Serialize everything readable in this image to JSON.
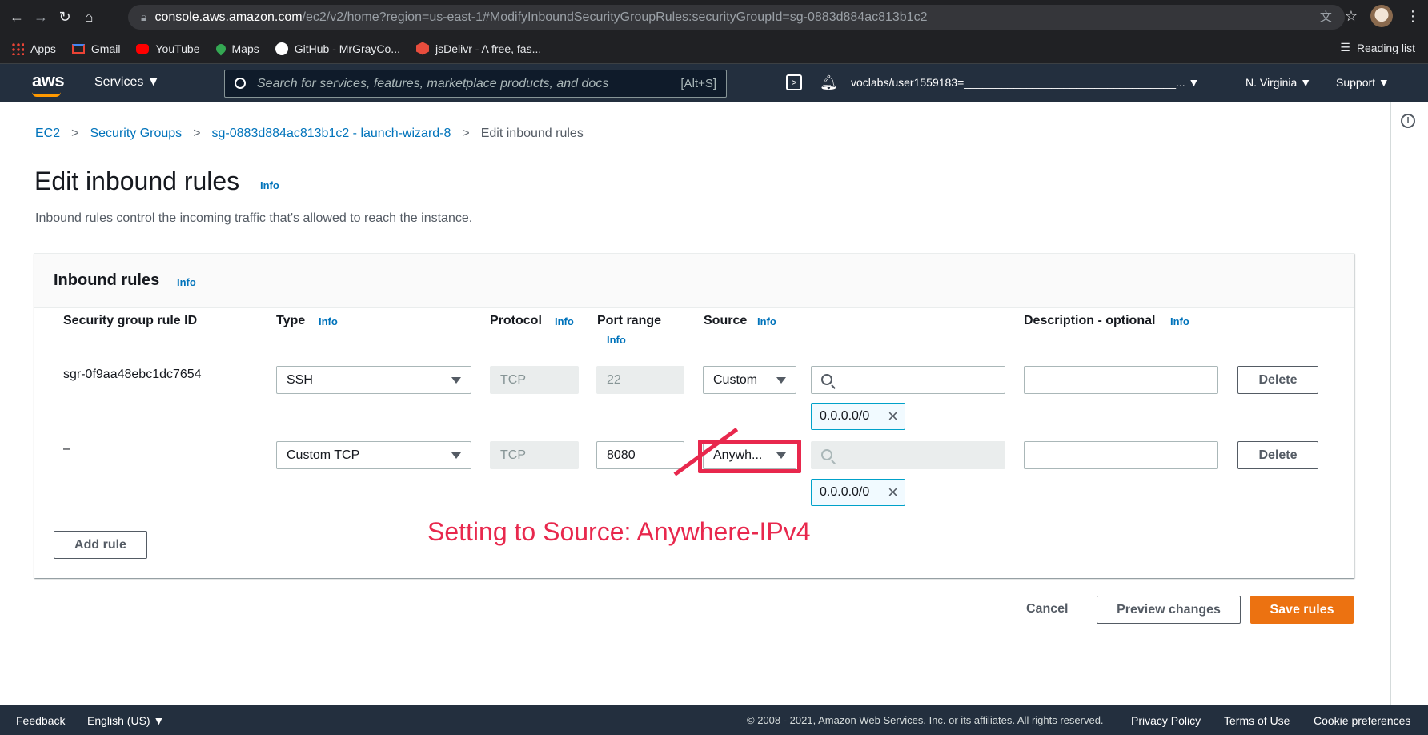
{
  "browser": {
    "url_host": "console.aws.amazon.com",
    "url_path": "/ec2/v2/home?region=us-east-1#ModifyInboundSecurityGroupRules:securityGroupId=sg-0883d884ac813b1c2",
    "bookmarks": [
      {
        "label": "Apps",
        "icon": "apps-grid-icon"
      },
      {
        "label": "Gmail",
        "icon": "gmail-icon"
      },
      {
        "label": "YouTube",
        "icon": "youtube-icon"
      },
      {
        "label": "Maps",
        "icon": "maps-icon"
      },
      {
        "label": "GitHub - MrGrayCo...",
        "icon": "github-icon"
      },
      {
        "label": "jsDelivr - A free, fas...",
        "icon": "jsdelivr-icon"
      }
    ],
    "reading_list": "Reading list"
  },
  "aws_header": {
    "logo": "aws",
    "services": "Services ▼",
    "search_placeholder": "Search for services, features, marketplace products, and docs",
    "search_shortcut": "[Alt+S]",
    "account": "voclabs/user1559183=__________________________________... ▼",
    "region": "N. Virginia ▼",
    "support": "Support ▼"
  },
  "breadcrumb": {
    "items": [
      "EC2",
      "Security Groups",
      "sg-0883d884ac813b1c2 - launch-wizard-8"
    ],
    "current": "Edit inbound rules"
  },
  "page": {
    "title": "Edit inbound rules",
    "info": "Info",
    "description": "Inbound rules control the incoming traffic that's allowed to reach the instance."
  },
  "panel": {
    "title": "Inbound rules",
    "info": "Info",
    "columns": {
      "rule_id": "Security group rule ID",
      "type": "Type",
      "protocol": "Protocol",
      "port_range": "Port range",
      "source": "Source",
      "description": "Description - optional"
    },
    "rules": [
      {
        "rule_id": "sgr-0f9aa48ebc1dc7654",
        "type": "SSH",
        "protocol": "TCP",
        "port_range": "22",
        "source": "Custom",
        "cidr_token": "0.0.0.0/0",
        "delete": "Delete"
      },
      {
        "rule_id": "–",
        "type": "Custom TCP",
        "protocol": "TCP",
        "port_range": "8080",
        "source": "Anywh...",
        "cidr_token": "0.0.0.0/0",
        "delete": "Delete"
      }
    ],
    "add_rule": "Add rule"
  },
  "annotation": "Setting to Source: Anywhere-IPv4",
  "actions": {
    "cancel": "Cancel",
    "preview": "Preview changes",
    "save": "Save rules"
  },
  "footer": {
    "feedback": "Feedback",
    "language": "English (US) ▼",
    "copyright": "© 2008 - 2021, Amazon Web Services, Inc. or its affiliates. All rights reserved.",
    "privacy": "Privacy Policy",
    "terms": "Terms of Use",
    "cookies": "Cookie preferences"
  },
  "colors": {
    "aws_nav": "#232f3e",
    "link": "#0073bb",
    "primary_button": "#ec7211",
    "annotation": "#e8284d"
  }
}
